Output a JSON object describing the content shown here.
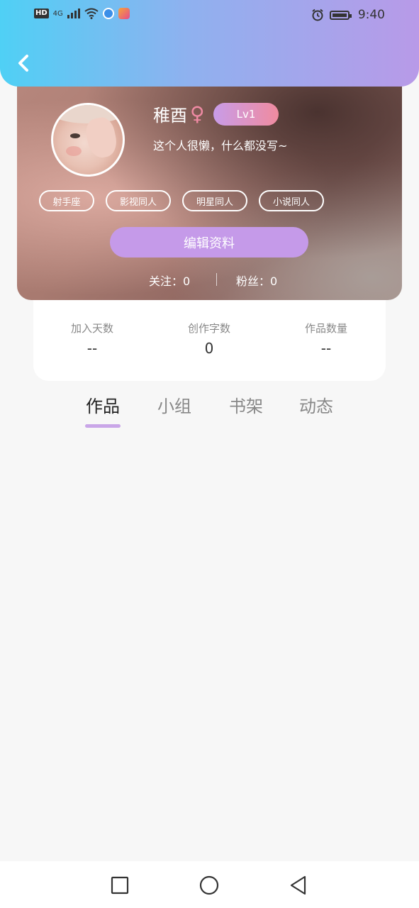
{
  "status_bar": {
    "hd": "HD",
    "network": "4G",
    "time": "9:40"
  },
  "profile": {
    "name": "稚酉",
    "level": "Lv1",
    "bio": "这个人很懒，什么都没写~",
    "tags": [
      "射手座",
      "影视同人",
      "明星同人",
      "小说同人"
    ],
    "edit_label": "编辑资料",
    "following": "关注：0",
    "fans": "粉丝：0"
  },
  "stats": [
    {
      "label": "加入天数",
      "value": "--"
    },
    {
      "label": "创作字数",
      "value": "0"
    },
    {
      "label": "作品数量",
      "value": "--"
    }
  ],
  "tabs": [
    "作品",
    "小组",
    "书架",
    "动态"
  ],
  "active_tab": 0,
  "colors": {
    "header_start": "#4fd0f5",
    "header_end": "#b89ae8",
    "accent": "#c59ae9",
    "female_symbol": "#ef8aa3"
  }
}
